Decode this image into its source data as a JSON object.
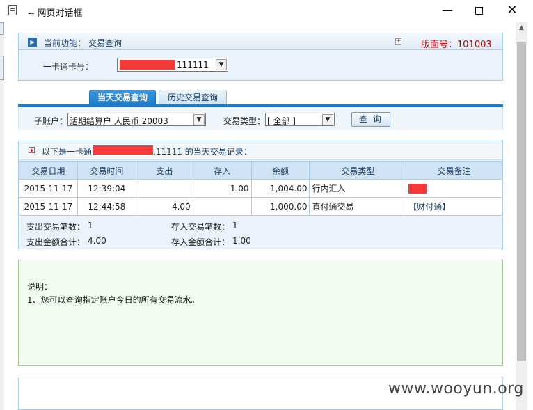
{
  "window": {
    "title": "-- 网页对话框"
  },
  "header": {
    "func_label": "当前功能：",
    "func_value": "交易查询",
    "version": "版面号：101003"
  },
  "card": {
    "label": "一卡通卡号：",
    "number_suffix": "111111"
  },
  "tabs": [
    {
      "label": "当天交易查询",
      "active": true
    },
    {
      "label": "历史交易查询",
      "active": false
    }
  ],
  "filters": {
    "sub_account_label": "子账户：",
    "sub_account_value": "活期结算户 人民币 20003",
    "type_label": "交易类型：",
    "type_value": "[ 全部 ]",
    "query_button": "查 询"
  },
  "records": {
    "heading_prefix": "以下是一卡通",
    "heading_suffix": ".11111 的当天交易记录：",
    "columns": [
      "交易日期",
      "交易时间",
      "支出",
      "存入",
      "余额",
      "交易类型",
      "交易备注"
    ],
    "rows": [
      [
        "2015-11-17",
        "12:39:04",
        "",
        "1.00",
        "1,004.00",
        "行内汇入",
        ""
      ],
      [
        "2015-11-17",
        "12:44:58",
        "4.00",
        "",
        "1,000.00",
        "直付通交易",
        "【财付通】"
      ]
    ]
  },
  "summary": {
    "out_count_label": "支出交易笔数：",
    "out_count": "1",
    "in_count_label": "存入交易笔数：",
    "in_count": "1",
    "out_total_label": "支出金额合计：",
    "out_total": "4.00",
    "in_total_label": "存入金额合计：",
    "in_total": "1.00"
  },
  "explanation": {
    "heading": "说明：",
    "line1": "1、您可以查询指定账户今日的所有交易流水。"
  },
  "watermark": "www.wooyun.org",
  "colors": {
    "accent": "#1f7cc8",
    "version_red": "#c00000",
    "redaction": "#f63a3a"
  }
}
